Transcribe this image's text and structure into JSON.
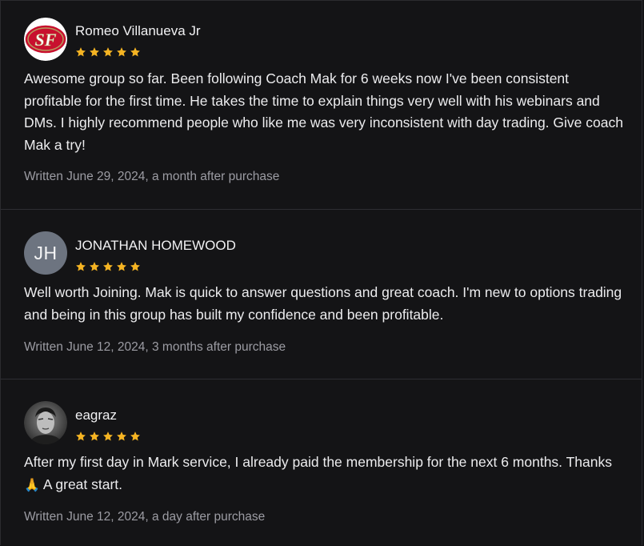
{
  "reviews": [
    {
      "name": "Romeo Villanueva Jr",
      "avatar": "sf-logo",
      "rating": 5,
      "text": "Awesome group so far. Been following Coach Mak for 6 weeks now I've been consistent profitable for the first time. He takes the time to explain things very well with his webinars and DMs. I highly recommend people who like me was very inconsistent with day trading. Give coach Mak a try!",
      "meta": "Written June 29, 2024, a month after purchase"
    },
    {
      "name": "JONATHAN HOMEWOOD",
      "avatar_initials": "JH",
      "rating": 5,
      "text": "Well worth Joining. Mak is quick to answer questions and great coach. I'm new to options trading and being in this group has built my confidence and been profitable.",
      "meta": "Written June 12, 2024, 3 months after purchase"
    },
    {
      "name": "eagraz",
      "avatar": "user-photo",
      "rating": 5,
      "text_before": "After my first day in Mark service, I already paid the membership for the next 6 months. Thanks",
      "emoji": "🙏",
      "text_after": " A great start.",
      "meta": "Written June 12, 2024, a day after purchase"
    }
  ],
  "colors": {
    "background": "#141416",
    "star": "#f5b423",
    "text": "#ececee",
    "muted": "#9c9ca3",
    "divider": "#2e2e33"
  },
  "icons": {
    "star": "star-icon",
    "pray": "folded-hands-emoji"
  }
}
